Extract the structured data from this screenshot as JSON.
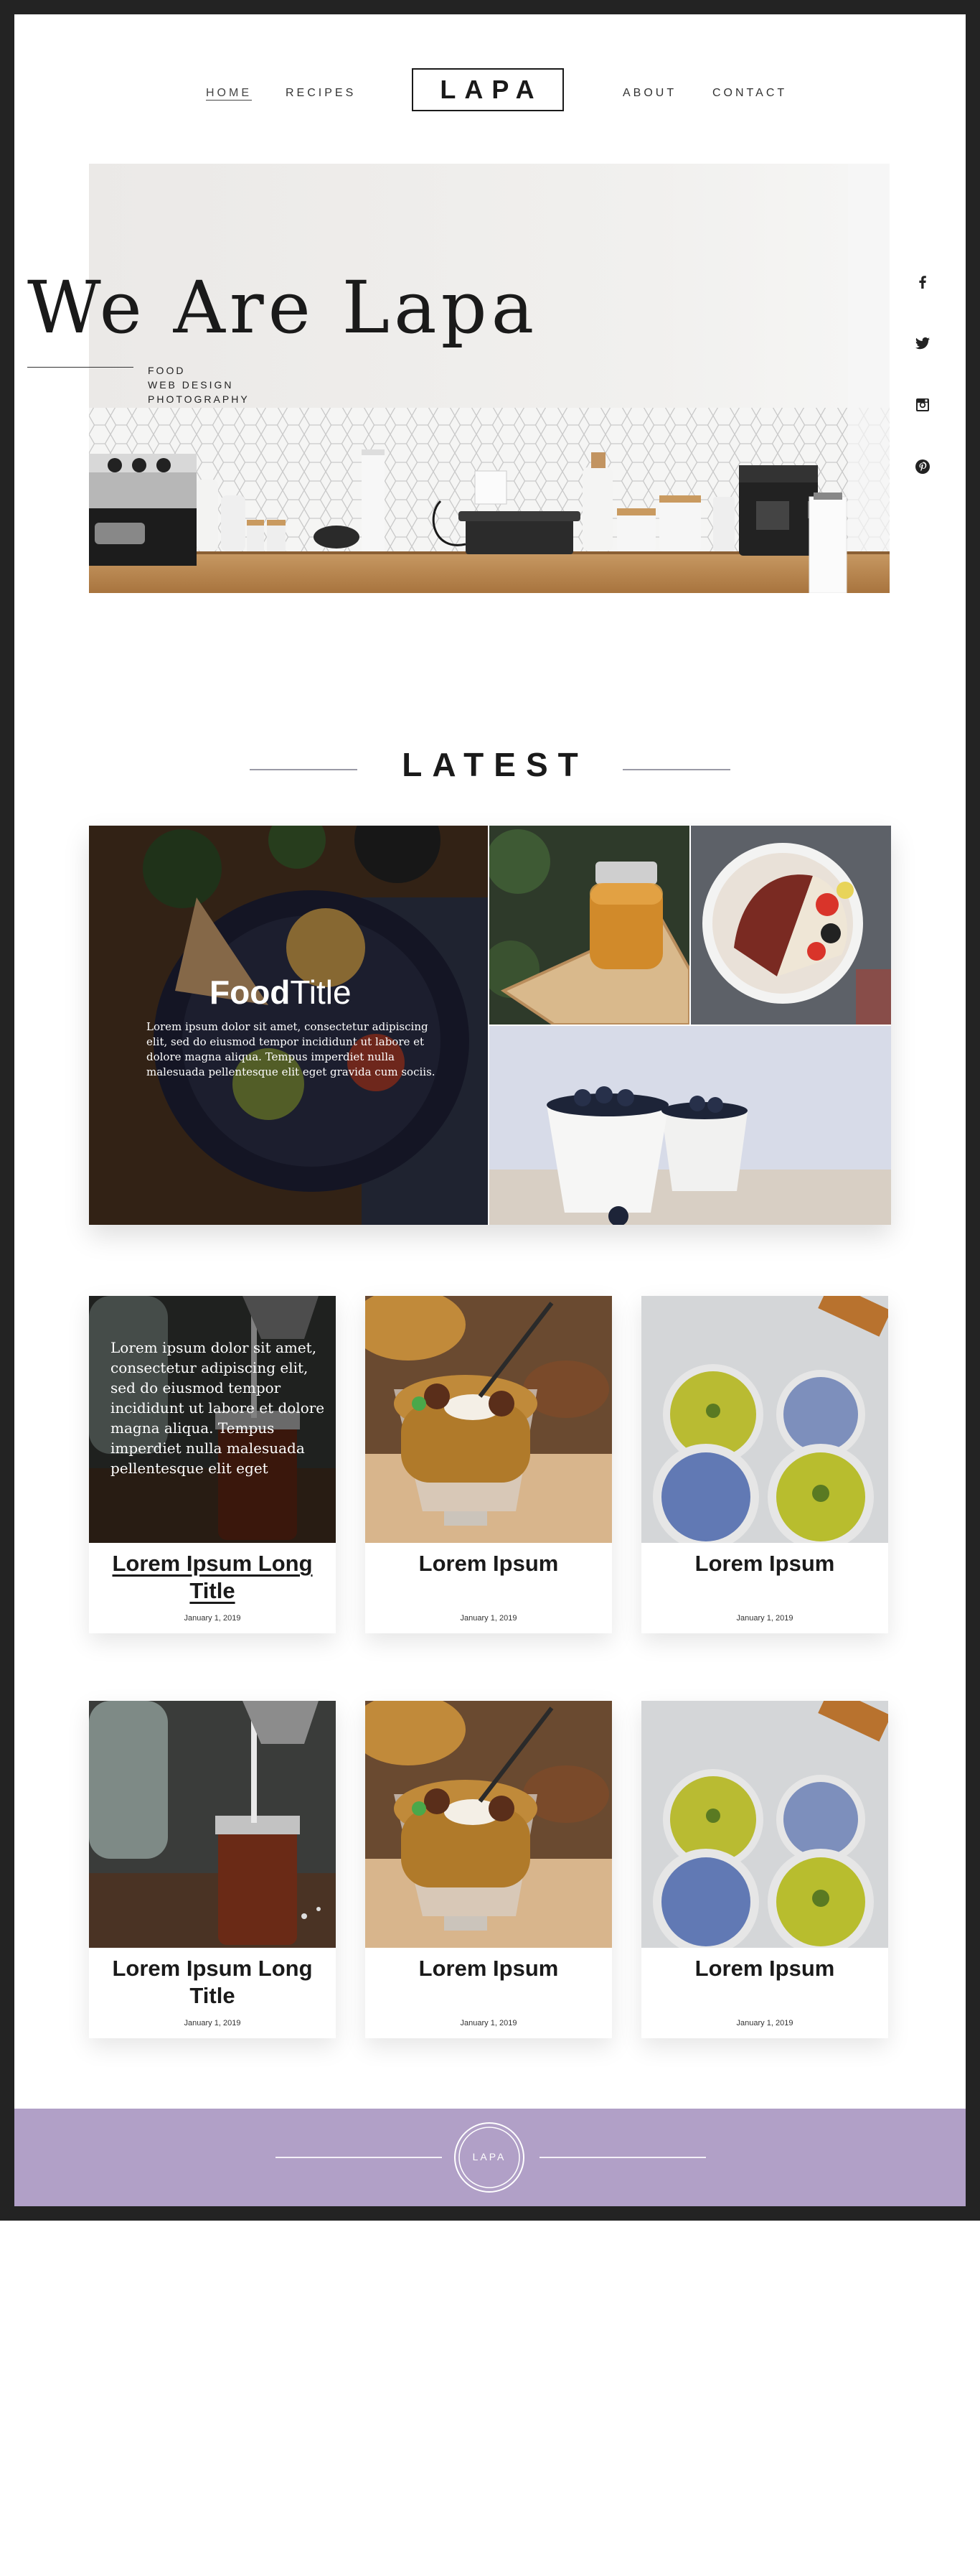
{
  "nav": {
    "left": [
      {
        "label": "HOME"
      },
      {
        "label": "RECIPES"
      }
    ],
    "logo": "LAPA",
    "right": [
      {
        "label": "ABOUT"
      },
      {
        "label": "CONTACT"
      }
    ]
  },
  "hero": {
    "title": "We Are Lapa",
    "tags": [
      "FOOD",
      "WEB DESIGN",
      "PHOTOGRAPHY"
    ]
  },
  "social": [
    "facebook-icon",
    "twitter-icon",
    "instagram-icon",
    "pinterest-icon"
  ],
  "latest": {
    "heading": "LATEST",
    "feature": {
      "title_bold": "Food",
      "title_light": "Title",
      "text": "Lorem ipsum dolor sit amet, consectetur adipiscing elit, sed do eiusmod tempor incididunt ut labore et dolore magna aliqua. Tempus imperdiet nulla malesuada pellentesque elit eget gravida cum sociis."
    }
  },
  "cards_row1": [
    {
      "title": "Lorem Ipsum Long Title",
      "date": "January 1, 2019",
      "overlay": "Lorem ipsum dolor sit amet, consectetur adipiscing elit, sed do eiusmod tempor incididunt ut labore et dolore magna aliqua. Tempus imperdiet nulla malesuada pellentesque elit eget"
    },
    {
      "title": "Lorem Ipsum",
      "date": "January 1, 2019"
    },
    {
      "title": "Lorem Ipsum",
      "date": "January 1, 2019"
    }
  ],
  "cards_row2": [
    {
      "title": "Lorem Ipsum Long Title",
      "date": "January 1, 2019"
    },
    {
      "title": "Lorem Ipsum",
      "date": "January 1, 2019"
    },
    {
      "title": "Lorem Ipsum",
      "date": "January 1, 2019"
    }
  ],
  "footer": {
    "logo": "LAPA",
    "color": "#b1a0c7"
  }
}
